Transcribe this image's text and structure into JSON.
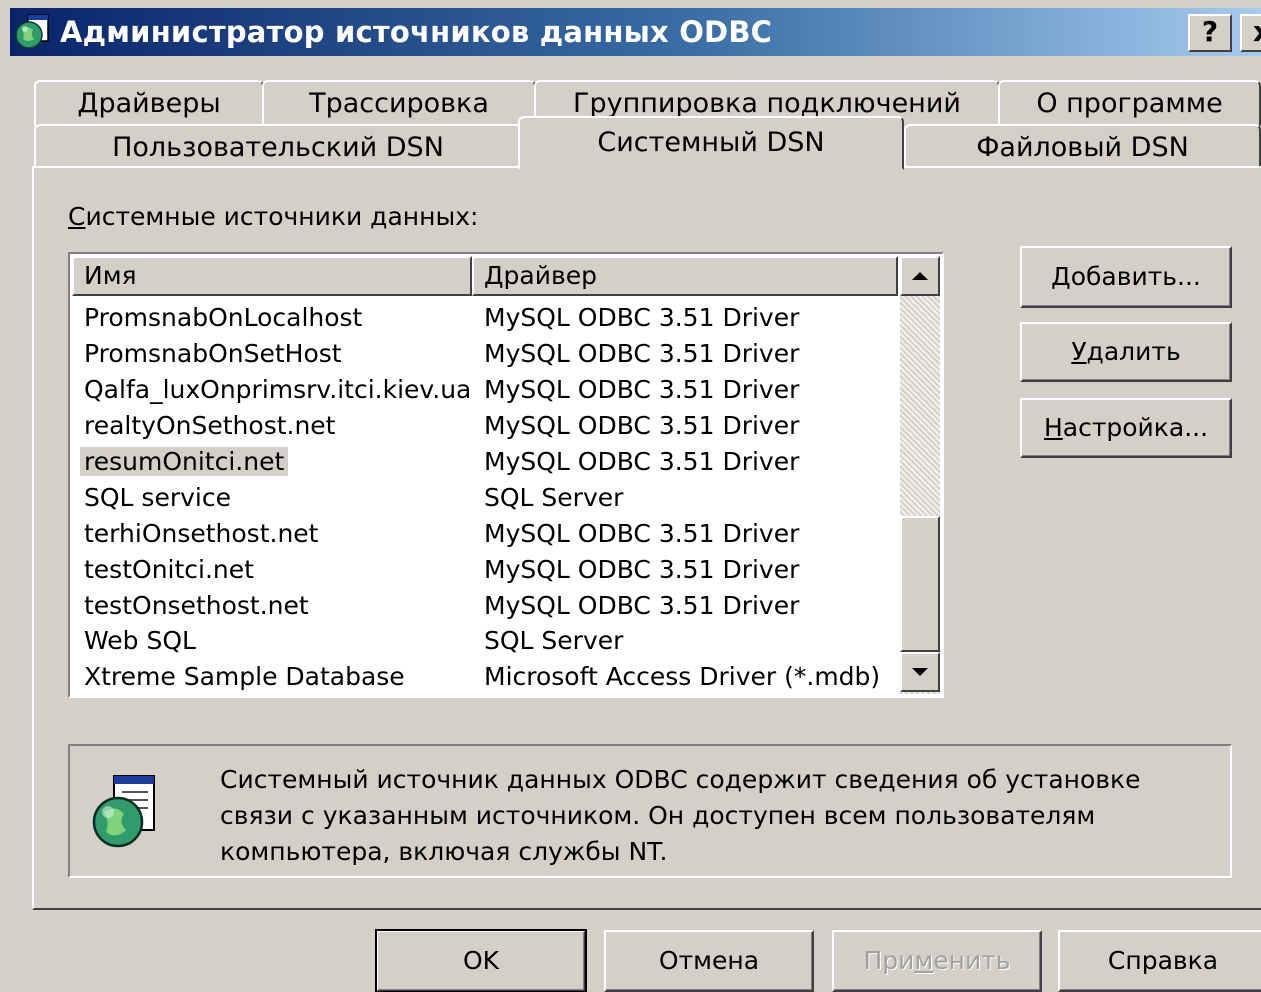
{
  "window": {
    "title": "Администратор источников данных ODBC",
    "help_button": "?",
    "close_button": "x"
  },
  "tabs_back": [
    "Драйверы",
    "Трассировка",
    "Группировка подключений",
    "О программе"
  ],
  "tabs_front": [
    "Пользовательский DSN",
    "Системный DSN",
    "Файловый DSN"
  ],
  "active_tab": "Системный DSN",
  "section": {
    "label_first": "С",
    "label_rest": "истемные источники данных:"
  },
  "list": {
    "columns": [
      "Имя",
      "Драйвер"
    ],
    "selected_index": 4,
    "rows": [
      {
        "name": "PromsnabOnLocalhost",
        "driver": "MySQL ODBC 3.51 Driver"
      },
      {
        "name": "PromsnabOnSetHost",
        "driver": "MySQL ODBC 3.51 Driver"
      },
      {
        "name": "Qalfa_luxOnprimsrv.itci.kiev.ua",
        "driver": "MySQL ODBC 3.51 Driver"
      },
      {
        "name": "realtyOnSethost.net",
        "driver": "MySQL ODBC 3.51 Driver"
      },
      {
        "name": "resumOnitci.net",
        "driver": "MySQL ODBC 3.51 Driver"
      },
      {
        "name": "SQL service",
        "driver": "SQL Server"
      },
      {
        "name": "terhiOnsethost.net",
        "driver": "MySQL ODBC 3.51 Driver"
      },
      {
        "name": "testOnitci.net",
        "driver": "MySQL ODBC 3.51 Driver"
      },
      {
        "name": "testOnsethost.net",
        "driver": "MySQL ODBC 3.51 Driver"
      },
      {
        "name": "Web SQL",
        "driver": "SQL Server"
      },
      {
        "name": "Xtreme Sample Database",
        "driver": "Microsoft Access Driver (*.mdb)"
      }
    ]
  },
  "side_buttons": {
    "add": {
      "mnemonic": "Д",
      "rest": "обавить..."
    },
    "remove": {
      "mnemonic": "У",
      "rest": "далить"
    },
    "configure": {
      "mnemonic": "Н",
      "rest": "астройка..."
    }
  },
  "info": {
    "icon": "odbc-globe-icon",
    "lines": [
      "Системный источник данных ODBC содержит сведения об установке",
      "связи с указанным источником. Он доступен всем пользователям",
      "компьютера, включая службы NT."
    ]
  },
  "bottom_buttons": {
    "ok": "OK",
    "cancel": "Отмена",
    "apply_pre": "При",
    "apply_mnemonic": "м",
    "apply_post": "енить",
    "help": "Справка"
  },
  "colors": {
    "face": "#d4d0c8",
    "title_start": "#0a246a",
    "title_end": "#a6caf0"
  }
}
